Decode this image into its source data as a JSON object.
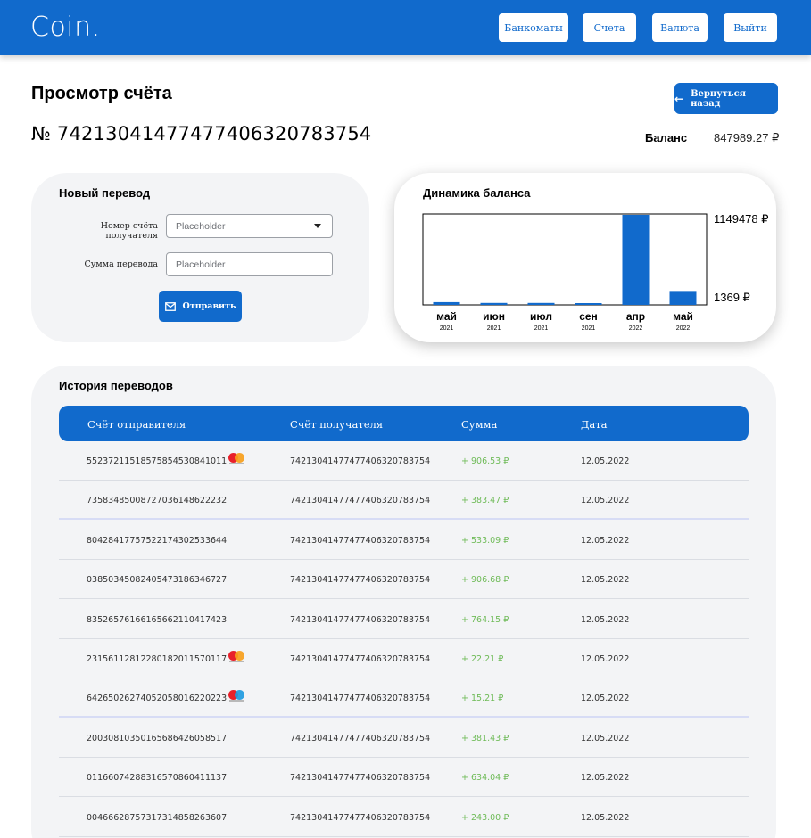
{
  "header": {
    "logo": "Coin.",
    "nav": [
      "Банкоматы",
      "Счета",
      "Валюта",
      "Выйти"
    ]
  },
  "page": {
    "title": "Просмотр счёта",
    "account_number": "№ 74213041477477406320783754",
    "back_label": "Вернуться назад",
    "back_icon": "arrow-left-icon",
    "balance_label": "Баланс",
    "balance_value": "847989.27 ₽"
  },
  "transfer": {
    "title": "Новый перевод",
    "recipient_label": "Номер счёта получателя",
    "recipient_placeholder": "Placeholder",
    "amount_label": "Сумма перевода",
    "amount_placeholder": "Placeholder",
    "send_label": "Отправить",
    "send_icon": "mail-icon"
  },
  "chart_data": {
    "type": "bar",
    "title": "Динамика баланса",
    "categories": [
      "май",
      "июн",
      "июл",
      "сен",
      "апр",
      "май"
    ],
    "years": [
      "2021",
      "2021",
      "2021",
      "2021",
      "2022",
      "2022"
    ],
    "values": [
      35000,
      25000,
      25000,
      12000,
      1149478,
      178000
    ],
    "ylim": [
      0,
      1149478
    ],
    "ytick_labels": [
      "1149478 ₽",
      "1369 ₽"
    ],
    "bar_color": "#116acc",
    "grid": false
  },
  "history": {
    "title": "История переводов",
    "columns": [
      "Счёт отправителя",
      "Счёт получателя",
      "Сумма",
      "Дата"
    ],
    "rows": [
      {
        "from": "55237211518575854530841011",
        "to": "74213041477477406320783754",
        "amount": "+ 906.53 ₽",
        "date": "12.05.2022",
        "card": "mastercard"
      },
      {
        "from": "73583485008727036148622232",
        "to": "74213041477477406320783754",
        "amount": "+ 383.47 ₽",
        "date": "12.05.2022",
        "card": ""
      },
      {
        "from": "80428417757522174302533644",
        "to": "74213041477477406320783754",
        "amount": "+ 533.09 ₽",
        "date": "12.05.2022",
        "card": ""
      },
      {
        "from": "03850345082405473186346727",
        "to": "74213041477477406320783754",
        "amount": "+ 906.68 ₽",
        "date": "12.05.2022",
        "card": ""
      },
      {
        "from": "83526576166165662110417423",
        "to": "74213041477477406320783754",
        "amount": "+ 764.15 ₽",
        "date": "12.05.2022",
        "card": ""
      },
      {
        "from": "23156112812280182011570117",
        "to": "74213041477477406320783754",
        "amount": "+ 22.21 ₽",
        "date": "12.05.2022",
        "card": "mastercard"
      },
      {
        "from": "64265026274052058016220223",
        "to": "74213041477477406320783754",
        "amount": "+ 15.21 ₽",
        "date": "12.05.2022",
        "card": "maestro"
      },
      {
        "from": "20030810350165686426058517",
        "to": "74213041477477406320783754",
        "amount": "+ 381.43 ₽",
        "date": "12.05.2022",
        "card": ""
      },
      {
        "from": "01166074288316570860411137",
        "to": "74213041477477406320783754",
        "amount": "+ 634.04 ₽",
        "date": "12.05.2022",
        "card": ""
      },
      {
        "from": "00466628757317314858263607",
        "to": "74213041477477406320783754",
        "amount": "+ 243.00 ₽",
        "date": "12.05.2022",
        "card": ""
      }
    ]
  }
}
